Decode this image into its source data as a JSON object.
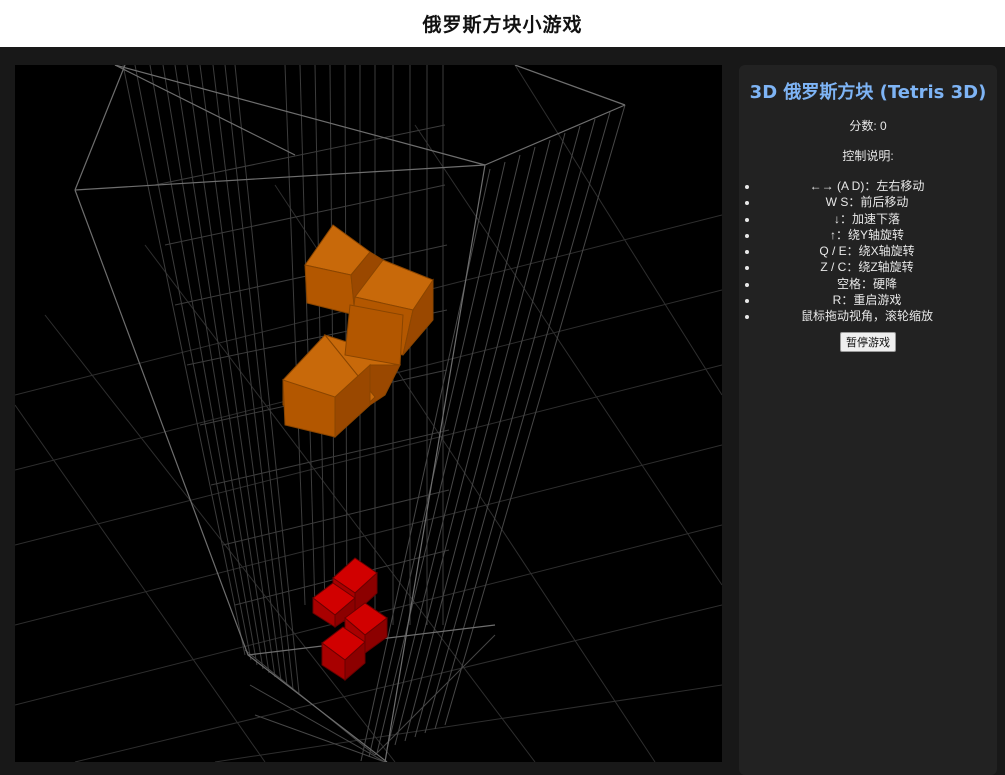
{
  "page": {
    "title": "俄罗斯方块小游戏"
  },
  "panel": {
    "title": "3D 俄罗斯方块 (Tetris 3D)",
    "score_line": "分数: 0",
    "controls_heading": "控制说明:",
    "controls": [
      "←→ (A D)：左右移动",
      "W S：前后移动",
      "↓：加速下落",
      "↑：绕Y轴旋转",
      "Q / E：绕X轴旋转",
      "Z / C：绕Z轴旋转",
      "空格：硬降",
      "R：重启游戏",
      "鼠标拖动视角，滚轮缩放"
    ],
    "pause_label": "暂停游戏"
  },
  "game": {
    "falling_piece": {
      "color": "#c86400"
    },
    "landed_piece": {
      "color": "#cc0000"
    },
    "grid_color": "#555555"
  }
}
